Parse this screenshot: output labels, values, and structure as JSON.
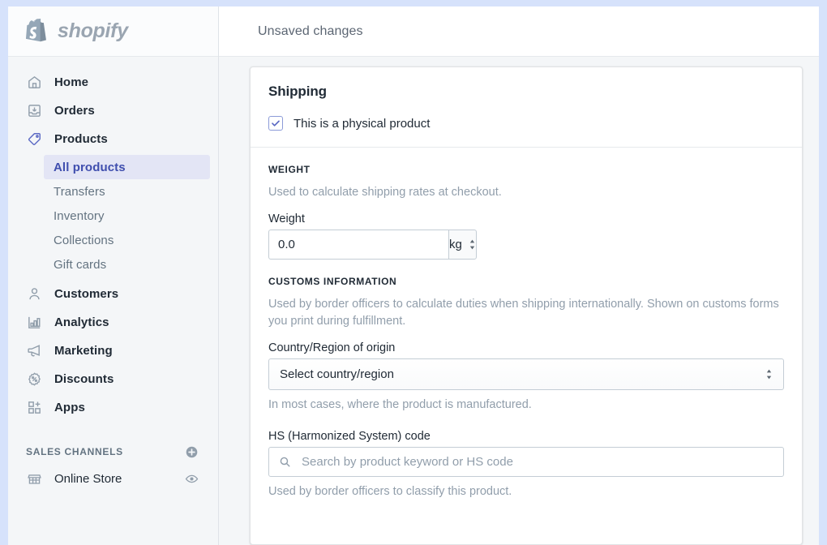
{
  "brand": {
    "name": "shopify",
    "logo_icon": "shopify-bag-icon"
  },
  "sidebar": {
    "nav": [
      {
        "label": "Home",
        "icon": "home-icon",
        "active": false
      },
      {
        "label": "Orders",
        "icon": "orders-inbox-icon",
        "active": false
      },
      {
        "label": "Products",
        "icon": "products-tag-icon",
        "active": true
      },
      {
        "label": "Customers",
        "icon": "customer-person-icon",
        "active": false
      },
      {
        "label": "Analytics",
        "icon": "analytics-bar-chart-icon",
        "active": false
      },
      {
        "label": "Marketing",
        "icon": "marketing-megaphone-icon",
        "active": false
      },
      {
        "label": "Discounts",
        "icon": "discounts-percent-badge-icon",
        "active": false
      },
      {
        "label": "Apps",
        "icon": "apps-grid-plus-icon",
        "active": false
      }
    ],
    "products_sub": [
      {
        "label": "All products",
        "selected": true
      },
      {
        "label": "Transfers",
        "selected": false
      },
      {
        "label": "Inventory",
        "selected": false
      },
      {
        "label": "Collections",
        "selected": false
      },
      {
        "label": "Gift cards",
        "selected": false
      }
    ],
    "sales_channels": {
      "title": "SALES CHANNELS",
      "add_icon": "plus-circle-icon",
      "items": [
        {
          "label": "Online Store",
          "icon": "online-store-icon",
          "action_icon": "eye-icon"
        }
      ]
    }
  },
  "topbar": {
    "title": "Unsaved changes"
  },
  "shipping_card": {
    "title": "Shipping",
    "physical_product": {
      "label": "This is a physical product",
      "checked": true,
      "icon": "checkmark-icon"
    },
    "weight": {
      "section_head": "WEIGHT",
      "helper": "Used to calculate shipping rates at checkout.",
      "field_label": "Weight",
      "value": "0.0",
      "unit": "kg",
      "unit_icon": "select-chevrons-icon"
    },
    "customs": {
      "section_head": "CUSTOMS INFORMATION",
      "helper": "Used by border officers to calculate duties when shipping internationally. Shown on customs forms you print during fulfillment.",
      "country": {
        "label": "Country/Region of origin",
        "value": "Select country/region",
        "icon": "select-chevrons-icon",
        "helper": "In most cases, where the product is manufactured."
      },
      "hs_code": {
        "label": "HS (Harmonized System) code",
        "placeholder": "Search by product keyword or HS code",
        "value": "",
        "icon": "search-icon",
        "helper": "Used by border officers to classify this product."
      }
    }
  },
  "colors": {
    "page_background": "#d6e2fb",
    "sidebar_background": "#f4f6f8",
    "content_background": "#f4f6f8",
    "accent_indigo": "#5c6ac4",
    "active_item_background": "#e3e5f5",
    "active_item_text": "#3f4eae",
    "text_primary": "#212b36",
    "text_subdued": "#919eab"
  }
}
